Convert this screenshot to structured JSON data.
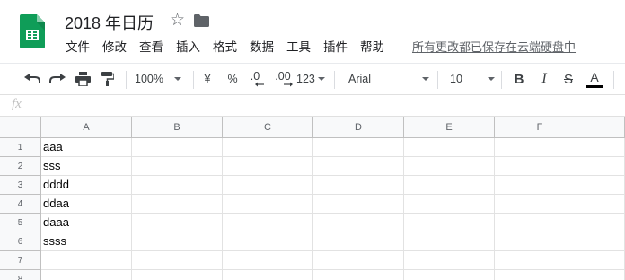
{
  "document": {
    "title": "2018 年日历",
    "save_status": "所有更改都已保存在云端硬盘中"
  },
  "menu": [
    "文件",
    "修改",
    "查看",
    "插入",
    "格式",
    "数据",
    "工具",
    "插件",
    "帮助"
  ],
  "toolbar": {
    "zoom": "100%",
    "currency": "¥",
    "percent": "%",
    "decimal_decrease": ".0",
    "decimal_increase": ".00",
    "number_format": "123",
    "font": "Arial",
    "font_size": "10",
    "bold": "B",
    "italic": "I",
    "strikethrough": "S",
    "text_color_letter": "A",
    "text_color": "#000000"
  },
  "formula_bar": {
    "label": "fx",
    "value": ""
  },
  "columns": [
    "A",
    "B",
    "C",
    "D",
    "E",
    "F"
  ],
  "rows": [
    {
      "num": "1",
      "cells": [
        "aaa",
        "",
        "",
        "",
        "",
        ""
      ]
    },
    {
      "num": "2",
      "cells": [
        "sss",
        "",
        "",
        "",
        "",
        ""
      ]
    },
    {
      "num": "3",
      "cells": [
        "dddd",
        "",
        "",
        "",
        "",
        ""
      ]
    },
    {
      "num": "4",
      "cells": [
        "ddaa",
        "",
        "",
        "",
        "",
        ""
      ]
    },
    {
      "num": "5",
      "cells": [
        "daaa",
        "",
        "",
        "",
        "",
        ""
      ]
    },
    {
      "num": "6",
      "cells": [
        "ssss",
        "",
        "",
        "",
        "",
        ""
      ]
    },
    {
      "num": "7",
      "cells": [
        "",
        "",
        "",
        "",
        "",
        ""
      ]
    },
    {
      "num": "8",
      "cells": [
        "",
        "",
        "",
        "",
        "",
        ""
      ]
    }
  ],
  "icons": {
    "logo": "sheets-logo-icon",
    "star": "star-icon",
    "folder": "folder-icon",
    "undo": "undo-icon",
    "redo": "redo-icon",
    "print": "print-icon",
    "paint_format": "paint-format-icon"
  },
  "colors": {
    "sheets_green": "#0f9d58",
    "header_bg": "#f8f9fa"
  }
}
